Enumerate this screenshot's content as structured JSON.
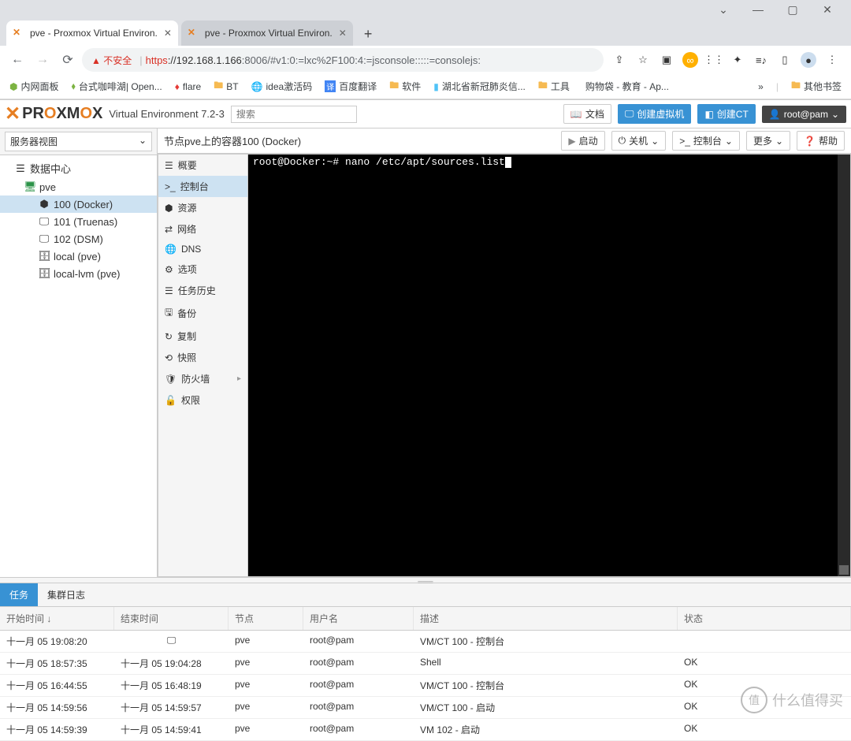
{
  "browser": {
    "tabs": [
      {
        "title": "pve - Proxmox Virtual Environ."
      },
      {
        "title": "pve - Proxmox Virtual Environ."
      }
    ],
    "address_warn": "不安全",
    "url_scheme": "https",
    "url_host": "://192.168.1.166",
    "url_port": ":8006",
    "url_path": "/#v1:0:=lxc%2F100:4:=jsconsole:::::=consolejs:",
    "bookmarks": [
      "内网面板",
      "台式咖啡湖| Open...",
      "flare",
      "BT",
      "idea激活码",
      "百度翻译",
      "软件",
      "湖北省新冠肺炎信...",
      "工具",
      "购物袋 - 教育 - Ap..."
    ],
    "bookmarks_more": "»",
    "bookmarks_other": "其他书签"
  },
  "pve": {
    "product": "Virtual Environment 7.2-3",
    "search_placeholder": "搜索",
    "btn_docs": "文档",
    "btn_create_vm": "创建虚拟机",
    "btn_create_ct": "创建CT",
    "btn_user": "root@pam",
    "tree_view_label": "服务器视图",
    "tree": {
      "datacenter": "数据中心",
      "node": "pve",
      "items": [
        "100 (Docker)",
        "101 (Truenas)",
        "102 (DSM)",
        "local (pve)",
        "local-lvm (pve)"
      ]
    },
    "content_title": "节点pve上的容器100 (Docker)",
    "action_start": "启动",
    "action_shutdown": "关机",
    "action_console": "控制台",
    "action_more": "更多",
    "action_help": "帮助",
    "side_menu": [
      "概要",
      "控制台",
      "资源",
      "网络",
      "DNS",
      "选项",
      "任务历史",
      "备份",
      "复制",
      "快照",
      "防火墙",
      "权限"
    ],
    "terminal_line": "root@Docker:~# nano /etc/apt/sources.list"
  },
  "tasks": {
    "tab_tasks": "任务",
    "tab_cluster": "集群日志",
    "col_start": "开始时间 ↓",
    "col_end": "结束时间",
    "col_node": "节点",
    "col_user": "用户名",
    "col_desc": "描述",
    "col_status": "状态",
    "rows": [
      {
        "start": "十一月 05 19:08:20",
        "end": "",
        "monitor": true,
        "node": "pve",
        "user": "root@pam",
        "desc": "VM/CT 100 - 控制台",
        "status": ""
      },
      {
        "start": "十一月 05 18:57:35",
        "end": "十一月 05 19:04:28",
        "node": "pve",
        "user": "root@pam",
        "desc": "Shell",
        "status": "OK"
      },
      {
        "start": "十一月 05 16:44:55",
        "end": "十一月 05 16:48:19",
        "node": "pve",
        "user": "root@pam",
        "desc": "VM/CT 100 - 控制台",
        "status": "OK"
      },
      {
        "start": "十一月 05 14:59:56",
        "end": "十一月 05 14:59:57",
        "node": "pve",
        "user": "root@pam",
        "desc": "VM/CT 100 - 启动",
        "status": "OK"
      },
      {
        "start": "十一月 05 14:59:39",
        "end": "十一月 05 14:59:41",
        "node": "pve",
        "user": "root@pam",
        "desc": "VM 102 - 启动",
        "status": "OK"
      }
    ]
  },
  "watermark": "什么值得买"
}
